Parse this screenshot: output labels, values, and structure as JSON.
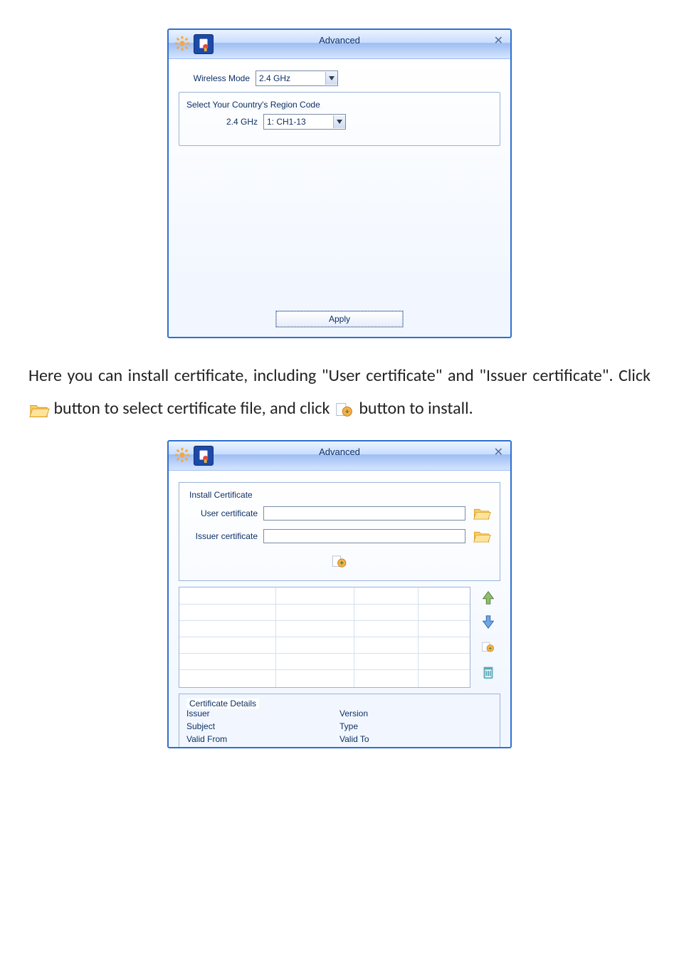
{
  "paragraph": {
    "p1a": "Here you can install certificate, including \"User certificate\" and \"Issuer certificate\". Click ",
    "p1b": " button to select certificate file, and click ",
    "p1c": " button to install."
  },
  "window1": {
    "title": "Advanced",
    "wireless_mode_label": "Wireless Mode",
    "wireless_mode_value": "2.4 GHz",
    "region_group_title": "Select Your Country's Region Code",
    "band_label": "2.4 GHz",
    "band_value": "1: CH1-13",
    "apply_label": "Apply"
  },
  "window2": {
    "title": "Advanced",
    "install_group_title": "Install Certificate",
    "user_cert_label": "User certificate",
    "issuer_cert_label": "Issuer certificate",
    "details_group_title": "Certificate Details",
    "details": {
      "issuer": "Issuer",
      "version": "Version",
      "subject": "Subject",
      "type": "Type",
      "valid_from": "Valid From",
      "valid_to": "Valid To"
    }
  },
  "icons": {
    "gear": "gear-icon",
    "cert_tab": "certificate-tab-icon",
    "close": "close-icon",
    "dropdown": "chevron-down-icon",
    "folder": "folder-open-icon",
    "install": "install-certificate-icon",
    "arrow_up": "arrow-up-icon",
    "arrow_down": "arrow-down-icon",
    "trash": "trash-icon"
  }
}
